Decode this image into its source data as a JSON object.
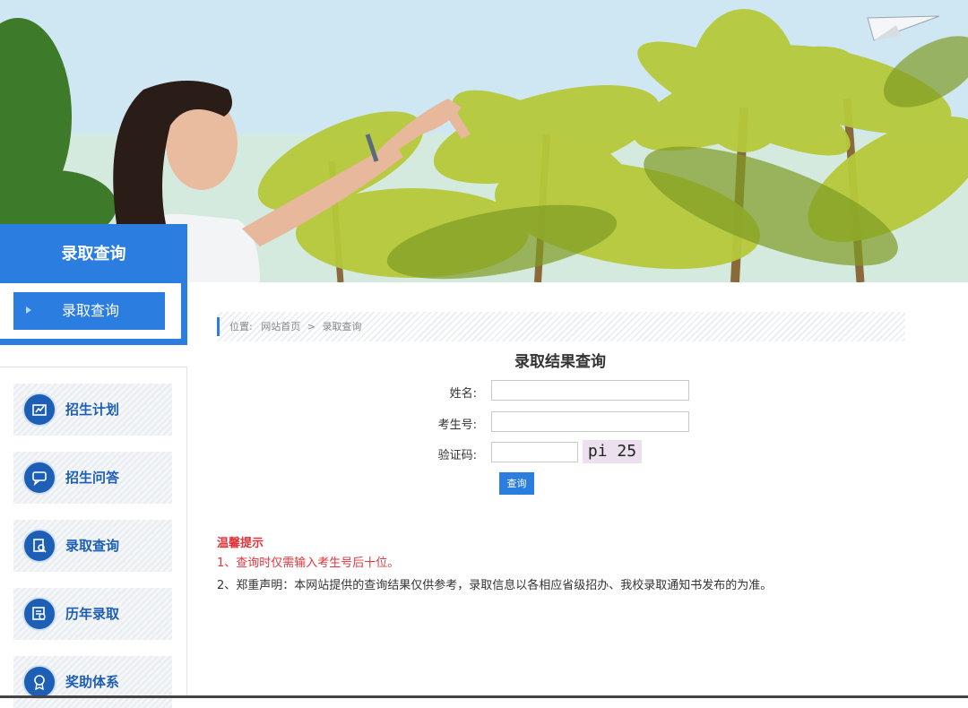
{
  "sidebar": {
    "title": "录取查询",
    "active_item": "录取查询",
    "menu": [
      {
        "label": "招生计划",
        "icon": "plan-icon"
      },
      {
        "label": "招生问答",
        "icon": "qa-icon"
      },
      {
        "label": "录取查询",
        "icon": "search-doc-icon"
      },
      {
        "label": "历年录取",
        "icon": "history-icon"
      },
      {
        "label": "奖助体系",
        "icon": "award-icon"
      }
    ]
  },
  "breadcrumb": {
    "prefix": "位置:",
    "home": "网站首页",
    "sep": ">",
    "current": "录取查询"
  },
  "form": {
    "title": "录取结果查询",
    "name_label": "姓名:",
    "name_value": "",
    "exam_label": "考生号:",
    "exam_value": "",
    "captcha_label": "验证码:",
    "captcha_value": "",
    "captcha_text": "pi 25",
    "submit_label": "查询"
  },
  "tips": {
    "title": "温馨提示",
    "line1": "1、查询时仅需输入考生号后十位。",
    "line2": "2、郑重声明：本网站提供的查询结果仅供参考，录取信息以各相应省级招办、我校录取通知书发布的为准。"
  },
  "colors": {
    "accent": "#2b7de0",
    "menu_icon": "#1d5fb5",
    "tip_red": "#e0343b"
  }
}
